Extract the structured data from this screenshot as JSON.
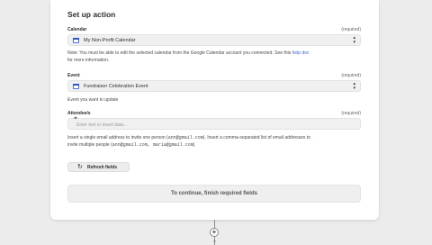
{
  "section": {
    "title": "Set up action"
  },
  "calendar": {
    "label": "Calendar",
    "required": "(required)",
    "value": "My Non-Profit Calendar",
    "note_prefix": "Note: You must be able to edit the selected calendar from the Google Calendar account you connected. See this",
    "note_link": "help doc",
    "note_suffix": "for more information."
  },
  "event": {
    "label": "Event",
    "required": "(required)",
    "value": "Fundraiser Celebration Event",
    "help": "Event you want to update"
  },
  "attendees": {
    "label": "Attendee/s",
    "required": "(required)",
    "placeholder": "Enter text or insert data...",
    "help_1": "Insert a single email address to invite one person (",
    "help_1_code": "ann@gmail.com",
    "help_2": "). Insert a comma-separated list of email addresses to",
    "help_3": "invite multiple people (",
    "help_3_code": "ann@gmail.com, maria@gmail.com",
    "help_4": ")"
  },
  "buttons": {
    "refresh": "Refresh fields",
    "continue": "To continue, finish required fields"
  },
  "icons": {
    "calendar": "calendar-icon",
    "refresh": "refresh-icon",
    "chevron": "up-down-chevron-icon",
    "add": "plus-icon"
  }
}
